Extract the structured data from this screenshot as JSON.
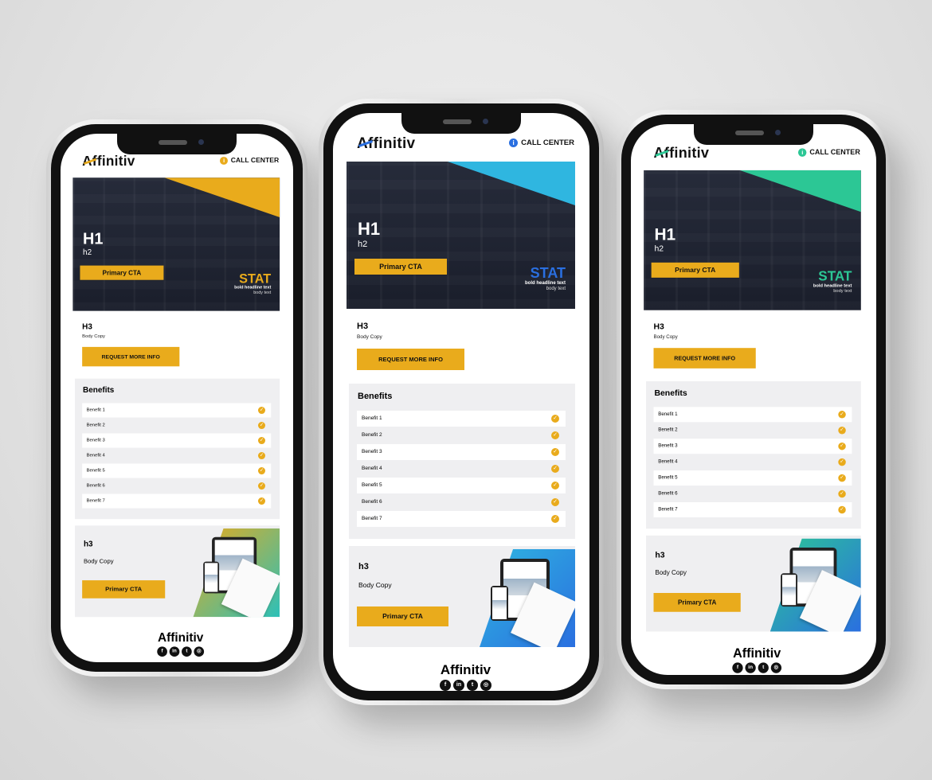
{
  "shared": {
    "logo": "Affinitiv",
    "call_center": "CALL CENTER",
    "hero": {
      "h1": "H1",
      "h2": "h2",
      "cta": "Primary CTA",
      "stat": "STAT",
      "bold_headline": "bold headline text",
      "body_text": "body text"
    },
    "intro": {
      "h3": "H3",
      "body": "Body Copy",
      "button": "REQUEST MORE INFO"
    },
    "benefits": {
      "title": "Benefits",
      "items": [
        "Benefit 1",
        "Benefit 2",
        "Benefit 3",
        "Benefit 4",
        "Benefit 5",
        "Benefit 6",
        "Benefit 7"
      ]
    },
    "promo": {
      "h3": "h3",
      "body": "Body Copy",
      "cta": "Primary CTA"
    },
    "footer": {
      "logo": "Affinitiv",
      "social_icons": [
        "facebook-icon",
        "linkedin-icon",
        "twitter-icon",
        "instagram-icon"
      ]
    }
  },
  "phones": [
    {
      "variant": "yellow",
      "accent": "#e9ab1c",
      "gradient": [
        "#e9ab1c",
        "#2cc0b8"
      ]
    },
    {
      "variant": "blue",
      "accent": "#2a6fe0",
      "gradient": [
        "#2fb6e0",
        "#2a6fe0"
      ]
    },
    {
      "variant": "green",
      "accent": "#2cc795",
      "gradient": [
        "#2cc795",
        "#2a6fe0"
      ]
    }
  ]
}
